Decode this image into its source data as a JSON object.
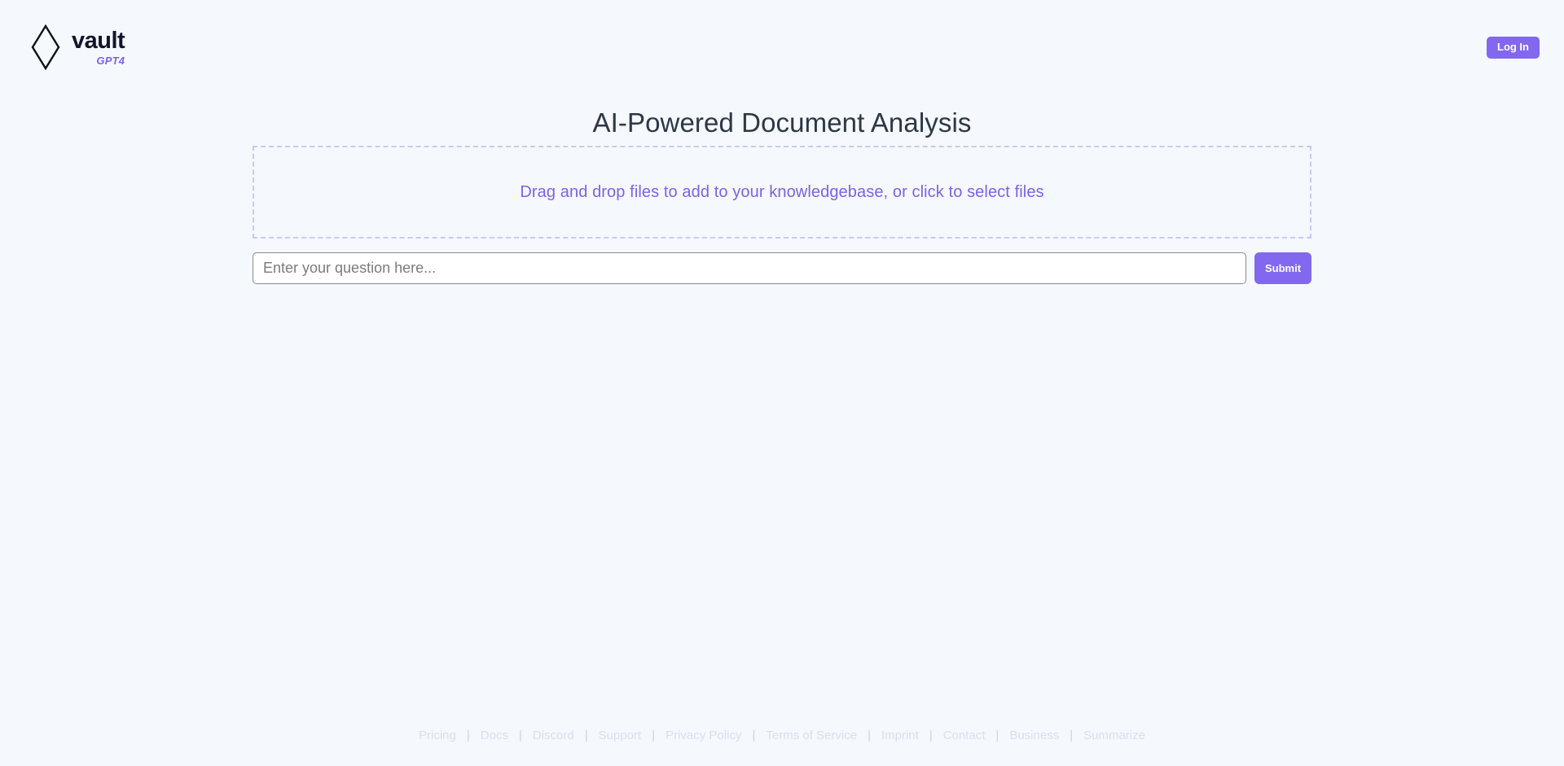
{
  "theme": {
    "background": "#f5f8fc",
    "accent_purple": "#8268ee",
    "dropzone_border": "#c8caf2",
    "dropzone_text": "#7c62e8",
    "footer_text": "#dcdcf2",
    "title_color": "#2d3748"
  },
  "header": {
    "logo": {
      "icon": "diamond-outline-icon",
      "name": "vault",
      "sub": "GPT4"
    },
    "login_label": "Log In"
  },
  "main": {
    "title": "AI-Powered Document Analysis",
    "dropzone": {
      "text": "Drag and drop files to add to your knowledgebase, or click to select files"
    },
    "query": {
      "placeholder": "Enter your question here...",
      "value": "",
      "submit_label": "Submit"
    }
  },
  "footer": {
    "separator": "|",
    "links": [
      {
        "label": "Pricing"
      },
      {
        "label": "Docs"
      },
      {
        "label": "Discord"
      },
      {
        "label": "Support"
      },
      {
        "label": "Privacy Policy"
      },
      {
        "label": "Terms of Service"
      },
      {
        "label": "Imprint"
      },
      {
        "label": "Contact"
      },
      {
        "label": "Business"
      },
      {
        "label": "Summarize"
      }
    ]
  }
}
